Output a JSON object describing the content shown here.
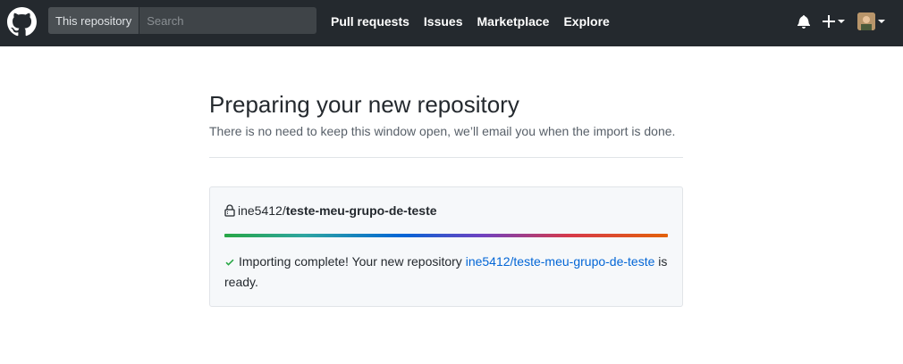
{
  "header": {
    "search_scope": "This repository",
    "search_placeholder": "Search",
    "nav": [
      "Pull requests",
      "Issues",
      "Marketplace",
      "Explore"
    ],
    "plus_label": "+"
  },
  "main": {
    "title": "Preparing your new repository",
    "subtitle": "There is no need to keep this window open, we’ll email you when the import is done.",
    "repo_owner": "ine5412/",
    "repo_name": "teste-meu-grupo-de-teste",
    "progress_fraction": 1.0,
    "status_prefix": "Importing complete! Your new repository ",
    "status_link": "ine5412/teste-meu-grupo-de-teste",
    "status_suffix": " is ready."
  },
  "colors": {
    "header_bg": "#24292e",
    "link": "#0366d6",
    "success": "#28a745"
  }
}
